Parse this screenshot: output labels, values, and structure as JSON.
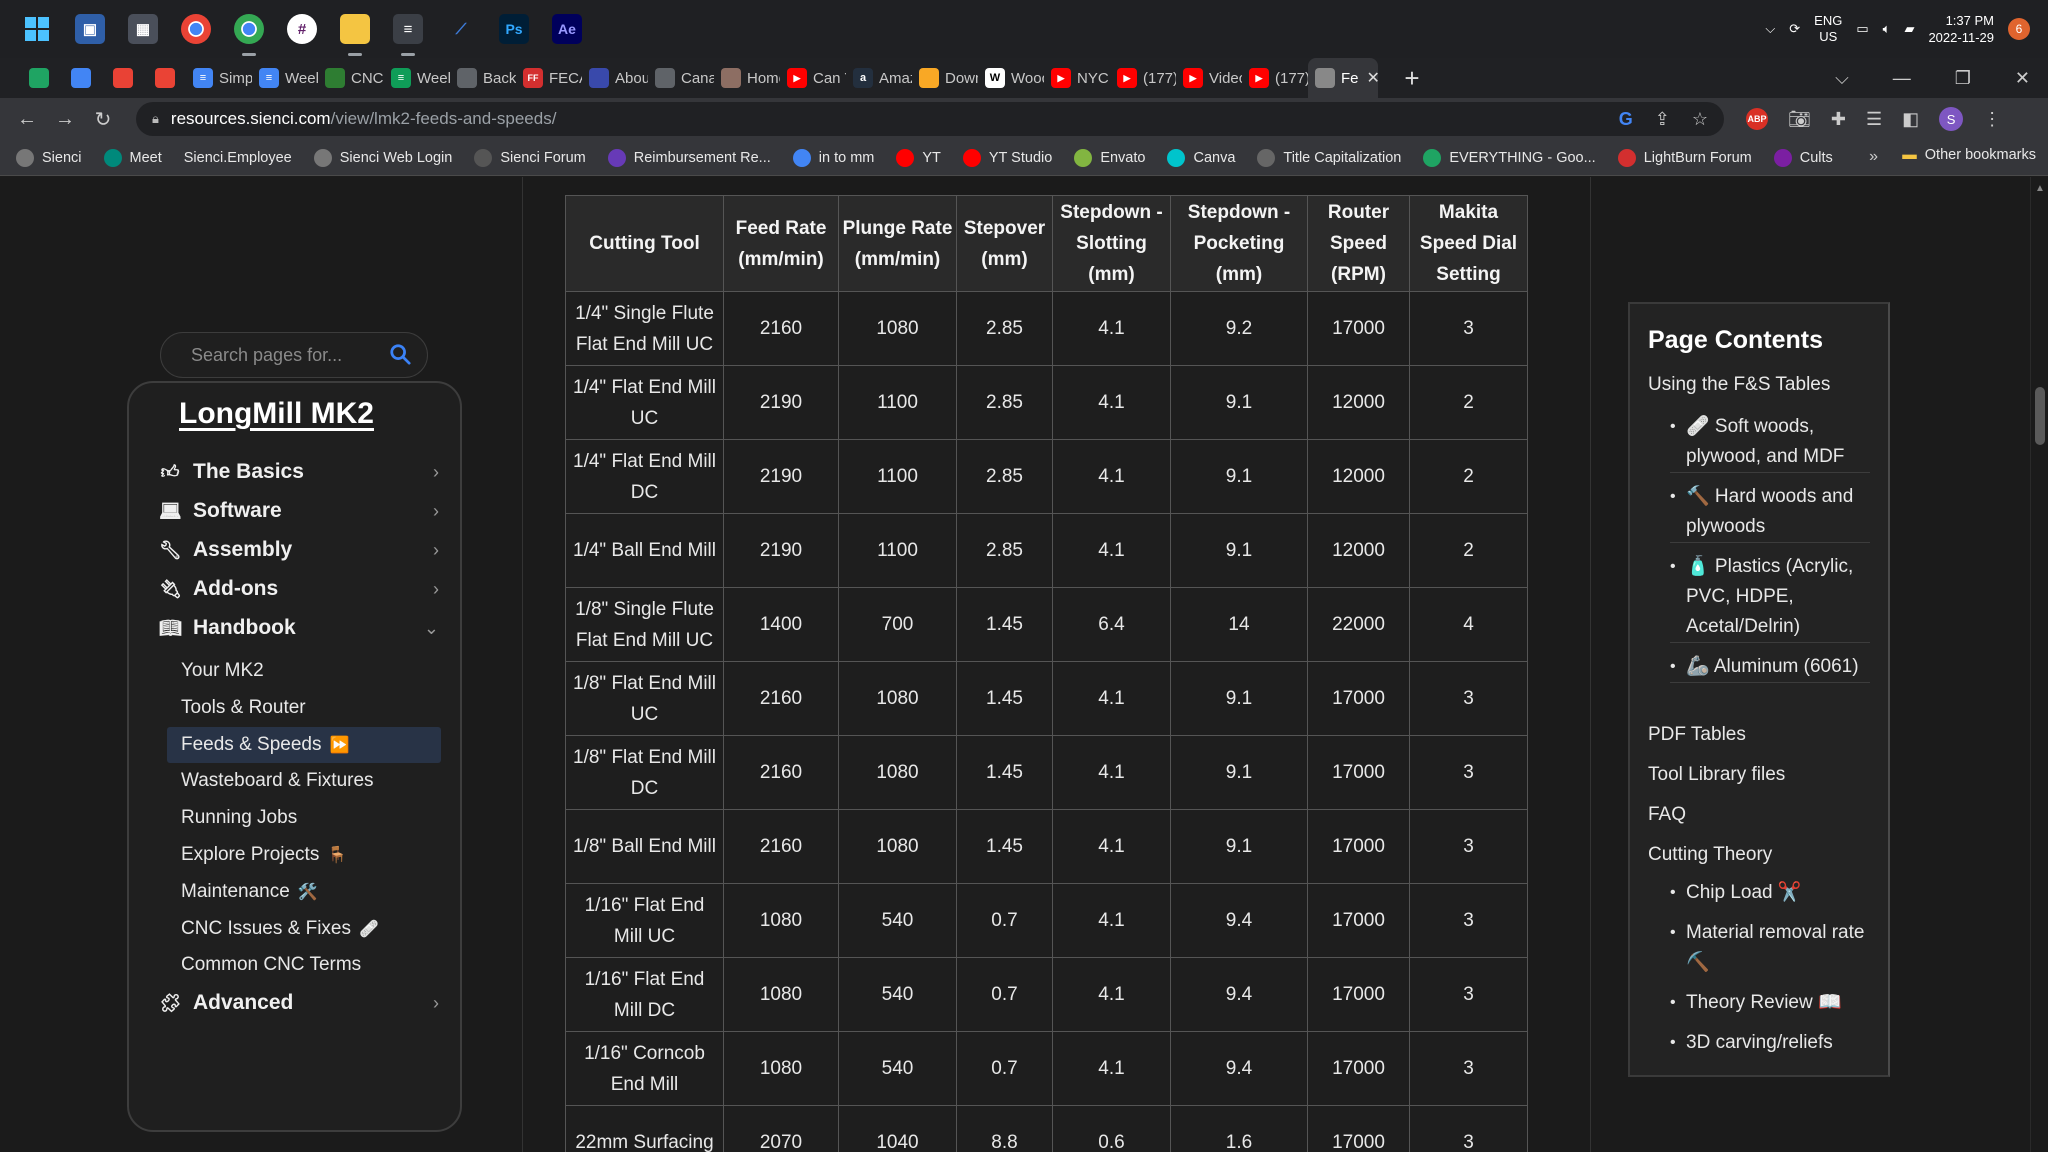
{
  "taskbar": {
    "lang_line1": "ENG",
    "lang_line2": "US",
    "time": "1:37 PM",
    "date": "2022-11-29",
    "notification_count": "6"
  },
  "tabs": [
    {
      "label": "",
      "icon": "google-drive-icon",
      "color": "#1fa463"
    },
    {
      "label": "",
      "icon": "google-icon",
      "color": "#4285f4"
    },
    {
      "label": "",
      "icon": "pinwheel-icon",
      "color": "#e94235"
    },
    {
      "label": "",
      "icon": "gmail-icon",
      "color": "#ea4335"
    },
    {
      "label": "Simpl",
      "icon": "docs-icon",
      "color": "#4285f4"
    },
    {
      "label": "Week",
      "icon": "docs-icon",
      "color": "#4285f4"
    },
    {
      "label": "CNC",
      "icon": "hex-icon",
      "color": "#2e7d32"
    },
    {
      "label": "Week",
      "icon": "sheets-icon",
      "color": "#0f9d58"
    },
    {
      "label": "Backl",
      "icon": "globe-icon",
      "color": "#5f6368"
    },
    {
      "label": "FECAI",
      "icon": "ff-icon",
      "color": "#d32f2f"
    },
    {
      "label": "Abou",
      "icon": "app-icon",
      "color": "#3949ab"
    },
    {
      "label": "Canac",
      "icon": "globe-icon",
      "color": "#5f6368"
    },
    {
      "label": "Home",
      "icon": "page-icon",
      "color": "#8d6e63"
    },
    {
      "label": "Can Y",
      "icon": "youtube-icon",
      "color": "#ff0000"
    },
    {
      "label": "Amaz",
      "icon": "amazon-icon",
      "color": "#232f3e"
    },
    {
      "label": "Down",
      "icon": "page-icon",
      "color": "#f9a825"
    },
    {
      "label": "Wooc",
      "icon": "wiki-icon",
      "color": "#ffffff"
    },
    {
      "label": "NYC C",
      "icon": "youtube-icon",
      "color": "#ff0000"
    },
    {
      "label": "(177)",
      "icon": "youtube-icon",
      "color": "#ff0000"
    },
    {
      "label": "Videc",
      "icon": "youtube-icon",
      "color": "#ff0000"
    },
    {
      "label": "(177)",
      "icon": "youtube-icon",
      "color": "#ff0000"
    },
    {
      "label": "Fe",
      "icon": "sienci-icon",
      "color": "#888888",
      "active": true
    }
  ],
  "address": {
    "host": "resources.sienci.com",
    "path": "/view/lmk2-feeds-and-speeds/"
  },
  "bookmarks": [
    {
      "label": "Sienci",
      "color": "#777777"
    },
    {
      "label": "Meet",
      "color": "#00897b"
    },
    {
      "label": "Sienci.Employee",
      "color": ""
    },
    {
      "label": "Sienci Web Login",
      "color": "#777777"
    },
    {
      "label": "Sienci  Forum",
      "color": "#555555"
    },
    {
      "label": "Reimbursement Re...",
      "color": "#673ab7"
    },
    {
      "label": "in to mm",
      "color": "#4285f4"
    },
    {
      "label": "YT",
      "color": "#ff0000"
    },
    {
      "label": "YT Studio",
      "color": "#ff0000"
    },
    {
      "label": "Envato",
      "color": "#82b541"
    },
    {
      "label": "Canva",
      "color": "#00c4cc"
    },
    {
      "label": "Title Capitalization",
      "color": "#666666"
    },
    {
      "label": "EVERYTHING - Goo...",
      "color": "#1fa463"
    },
    {
      "label": "LightBurn Forum",
      "color": "#d32f2f"
    },
    {
      "label": "Cults",
      "color": "#7b1fa2"
    }
  ],
  "bookmarks_other": "Other bookmarks",
  "search": {
    "placeholder": "Search pages for..."
  },
  "sidebar": {
    "title": "LongMill MK2",
    "sections": [
      {
        "label": "The Basics",
        "icon": "thumbs-up-icon",
        "expanded": false
      },
      {
        "label": "Software",
        "icon": "laptop-icon",
        "expanded": false
      },
      {
        "label": "Assembly",
        "icon": "wrench-icon",
        "expanded": false
      },
      {
        "label": "Add-ons",
        "icon": "plug-icon",
        "expanded": false
      },
      {
        "label": "Handbook",
        "icon": "book-icon",
        "expanded": true
      },
      {
        "label": "Advanced",
        "icon": "puzzle-icon",
        "expanded": false
      }
    ],
    "handbook_items": [
      {
        "label": "Your MK2",
        "emoji": ""
      },
      {
        "label": "Tools & Router",
        "emoji": ""
      },
      {
        "label": "Feeds & Speeds",
        "emoji": "⏩",
        "active": true
      },
      {
        "label": "Wasteboard & Fixtures",
        "emoji": ""
      },
      {
        "label": "Running Jobs",
        "emoji": ""
      },
      {
        "label": "Explore Projects",
        "emoji": "🪑"
      },
      {
        "label": "Maintenance",
        "emoji": "🛠️"
      },
      {
        "label": "CNC Issues & Fixes",
        "emoji": "🩹"
      },
      {
        "label": "Common CNC Terms",
        "emoji": ""
      }
    ]
  },
  "table": {
    "headers": [
      "Cutting Tool",
      "Feed Rate (mm/min)",
      "Plunge Rate (mm/min)",
      "Stepover (mm)",
      "Stepdown - Slotting (mm)",
      "Stepdown - Pocketing (mm)",
      "Router Speed (RPM)",
      "Makita Speed Dial Setting"
    ],
    "rows": [
      [
        "1/4\" Single Flute Flat End Mill UC",
        "2160",
        "1080",
        "2.85",
        "4.1",
        "9.2",
        "17000",
        "3"
      ],
      [
        "1/4\" Flat End Mill UC",
        "2190",
        "1100",
        "2.85",
        "4.1",
        "9.1",
        "12000",
        "2"
      ],
      [
        "1/4\" Flat End Mill DC",
        "2190",
        "1100",
        "2.85",
        "4.1",
        "9.1",
        "12000",
        "2"
      ],
      [
        "1/4\" Ball End Mill",
        "2190",
        "1100",
        "2.85",
        "4.1",
        "9.1",
        "12000",
        "2"
      ],
      [
        "1/8\" Single Flute Flat End Mill UC",
        "1400",
        "700",
        "1.45",
        "6.4",
        "14",
        "22000",
        "4"
      ],
      [
        "1/8\" Flat End Mill UC",
        "2160",
        "1080",
        "1.45",
        "4.1",
        "9.1",
        "17000",
        "3"
      ],
      [
        "1/8\" Flat End Mill DC",
        "2160",
        "1080",
        "1.45",
        "4.1",
        "9.1",
        "17000",
        "3"
      ],
      [
        "1/8\" Ball End Mill",
        "2160",
        "1080",
        "1.45",
        "4.1",
        "9.1",
        "17000",
        "3"
      ],
      [
        "1/16\" Flat End Mill UC",
        "1080",
        "540",
        "0.7",
        "4.1",
        "9.4",
        "17000",
        "3"
      ],
      [
        "1/16\" Flat End Mill DC",
        "1080",
        "540",
        "0.7",
        "4.1",
        "9.4",
        "17000",
        "3"
      ],
      [
        "1/16\" Corncob End Mill",
        "1080",
        "540",
        "0.7",
        "4.1",
        "9.4",
        "17000",
        "3"
      ],
      [
        "22mm Surfacing",
        "2070",
        "1040",
        "8.8",
        "0.6",
        "1.6",
        "17000",
        "3"
      ]
    ]
  },
  "contents": {
    "title": "Page Contents",
    "items": [
      {
        "label": "Using the F&S Tables",
        "level": 0
      },
      {
        "label": "🩹 Soft woods, plywood, and MDF",
        "level": 1
      },
      {
        "label": "🔨 Hard woods and plywoods",
        "level": 1
      },
      {
        "label": "🧴 Plastics (Acrylic, PVC, HDPE, Acetal/Delrin)",
        "level": 1
      },
      {
        "label": "🦾 Aluminum (6061)",
        "level": 1
      },
      {
        "label": "PDF Tables",
        "level": 0
      },
      {
        "label": "Tool Library files",
        "level": 0
      },
      {
        "label": "FAQ",
        "level": 0
      },
      {
        "label": "Cutting Theory",
        "level": 0
      },
      {
        "label": "Chip Load ✂️",
        "level": 1
      },
      {
        "label": "Material removal rate ⛏️",
        "level": 1
      },
      {
        "label": "Theory Review 📖",
        "level": 1
      },
      {
        "label": "3D carving/reliefs",
        "level": 1
      }
    ]
  }
}
